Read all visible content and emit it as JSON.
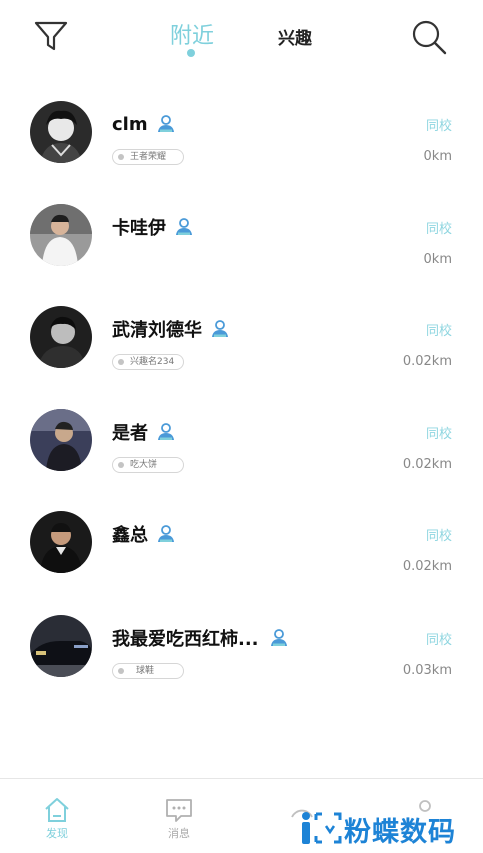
{
  "header": {
    "tabs": [
      {
        "label": "附近",
        "active": true
      },
      {
        "label": "兴趣",
        "active": false
      }
    ],
    "left_icon": "filter-icon",
    "right_icon": "search-icon"
  },
  "colors": {
    "accent": "#7fd0dc",
    "verify_badge": "#4a9ad8",
    "watermark": "#1d83d6"
  },
  "users": [
    {
      "name": "clm",
      "tag": "王者荣耀",
      "school": "同校",
      "distance": "0km"
    },
    {
      "name": "卡哇伊",
      "tag": "",
      "school": "同校",
      "distance": "0km"
    },
    {
      "name": "武清刘德华",
      "tag": "兴趣名234",
      "school": "同校",
      "distance": "0.02km"
    },
    {
      "name": "是者",
      "tag": "吃大饼",
      "school": "同校",
      "distance": "0.02km"
    },
    {
      "name": "鑫总",
      "tag": "",
      "school": "同校",
      "distance": "0.02km"
    },
    {
      "name": "我最爱吃西红柿...",
      "tag": "球鞋",
      "school": "同校",
      "distance": "0.03km"
    }
  ],
  "bottom_nav": [
    {
      "label": "发现",
      "icon": "home-icon",
      "active": true
    },
    {
      "label": "消息",
      "icon": "message-icon",
      "active": false
    }
  ],
  "watermark": {
    "text": "粉蝶数码"
  }
}
